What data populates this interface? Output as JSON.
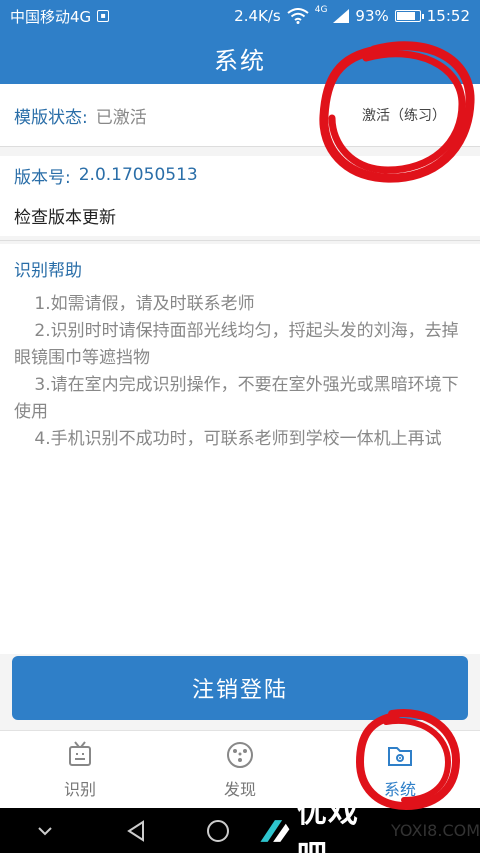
{
  "status_bar": {
    "carrier": "中国移动4G",
    "speed": "2.4K/s",
    "network": "4G",
    "battery": "93%",
    "time": "15:52"
  },
  "app_bar": {
    "title": "系统"
  },
  "template_status": {
    "label": "模版状态:",
    "value": "已激活",
    "action": "激活（练习）"
  },
  "version": {
    "label": "版本号:",
    "value": "2.0.17050513"
  },
  "check_update": {
    "label": "检查版本更新"
  },
  "help": {
    "title": "识别帮助",
    "items": [
      "1.如需请假，请及时联系老师",
      "2.识别时时请保持面部光线均匀，捋起头发的刘海，去掉眼镜围巾等遮挡物",
      "3.请在室内完成识别操作，不要在室外强光或黑暗环境下使用",
      "4.手机识别不成功时，可联系老师到学校一体机上再试"
    ]
  },
  "logout_button": {
    "label": "注销登陆"
  },
  "tabs": [
    {
      "label": "识别",
      "icon": "tv-icon"
    },
    {
      "label": "发现",
      "icon": "compass-icon"
    },
    {
      "label": "系统",
      "icon": "folder-gear-icon",
      "active": true
    }
  ],
  "watermark": {
    "brand": "优戏吧",
    "url": "YOXI8.COM"
  },
  "colors": {
    "primary": "#2f7fc8",
    "label_blue": "#2a6ea8",
    "annotation_red": "#e0121a"
  },
  "battery_level": 0.93
}
